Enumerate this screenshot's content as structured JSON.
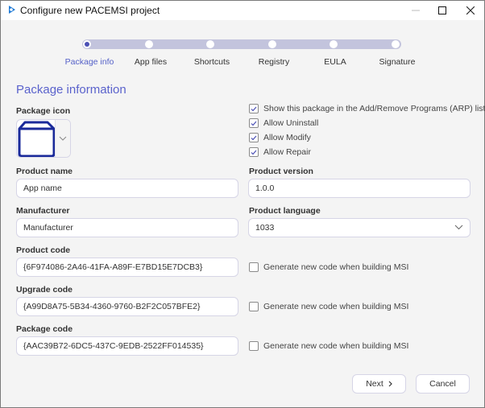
{
  "window": {
    "title": "Configure new PACEMSI project",
    "app_icon": "pacemsi-logo-icon",
    "controls": [
      "minimize-icon",
      "maximize-icon",
      "close-icon"
    ]
  },
  "stepper": {
    "steps": [
      {
        "label": "Package info",
        "active": true
      },
      {
        "label": "App files",
        "active": false
      },
      {
        "label": "Shortcuts",
        "active": false
      },
      {
        "label": "Registry",
        "active": false
      },
      {
        "label": "EULA",
        "active": false
      },
      {
        "label": "Signature",
        "active": false
      }
    ],
    "accent_color": "#5561c8",
    "track_color": "#c3c4dd"
  },
  "section": {
    "title": "Package information"
  },
  "package_icon": {
    "label": "Package icon",
    "icon": "box-icon"
  },
  "checkboxes": [
    {
      "label": "Show this package in the Add/Remove Programs (ARP) list",
      "checked": true
    },
    {
      "label": "Allow Uninstall",
      "checked": true
    },
    {
      "label": "Allow Modify",
      "checked": true
    },
    {
      "label": "Allow Repair",
      "checked": true
    }
  ],
  "fields": {
    "product_name": {
      "label": "Product name",
      "value": "App name"
    },
    "product_version": {
      "label": "Product version",
      "value": "1.0.0"
    },
    "manufacturer": {
      "label": "Manufacturer",
      "value": "Manufacturer"
    },
    "product_language": {
      "label": "Product language",
      "value": "1033"
    },
    "product_code": {
      "label": "Product code",
      "value": "{6F974086-2A46-41FA-A89F-E7BD15E7DCB3}",
      "generate_label": "Generate new code when building MSI",
      "generate_checked": false
    },
    "upgrade_code": {
      "label": "Upgrade code",
      "value": "{A99D8A75-5B34-4360-9760-B2F2C057BFE2}",
      "generate_label": "Generate new code when building MSI",
      "generate_checked": false
    },
    "package_code": {
      "label": "Package code",
      "value": "{AAC39B72-6DC5-437C-9EDB-2522FF014535}",
      "generate_label": "Generate new code when building MSI",
      "generate_checked": false
    }
  },
  "buttons": {
    "next": "Next",
    "cancel": "Cancel"
  }
}
